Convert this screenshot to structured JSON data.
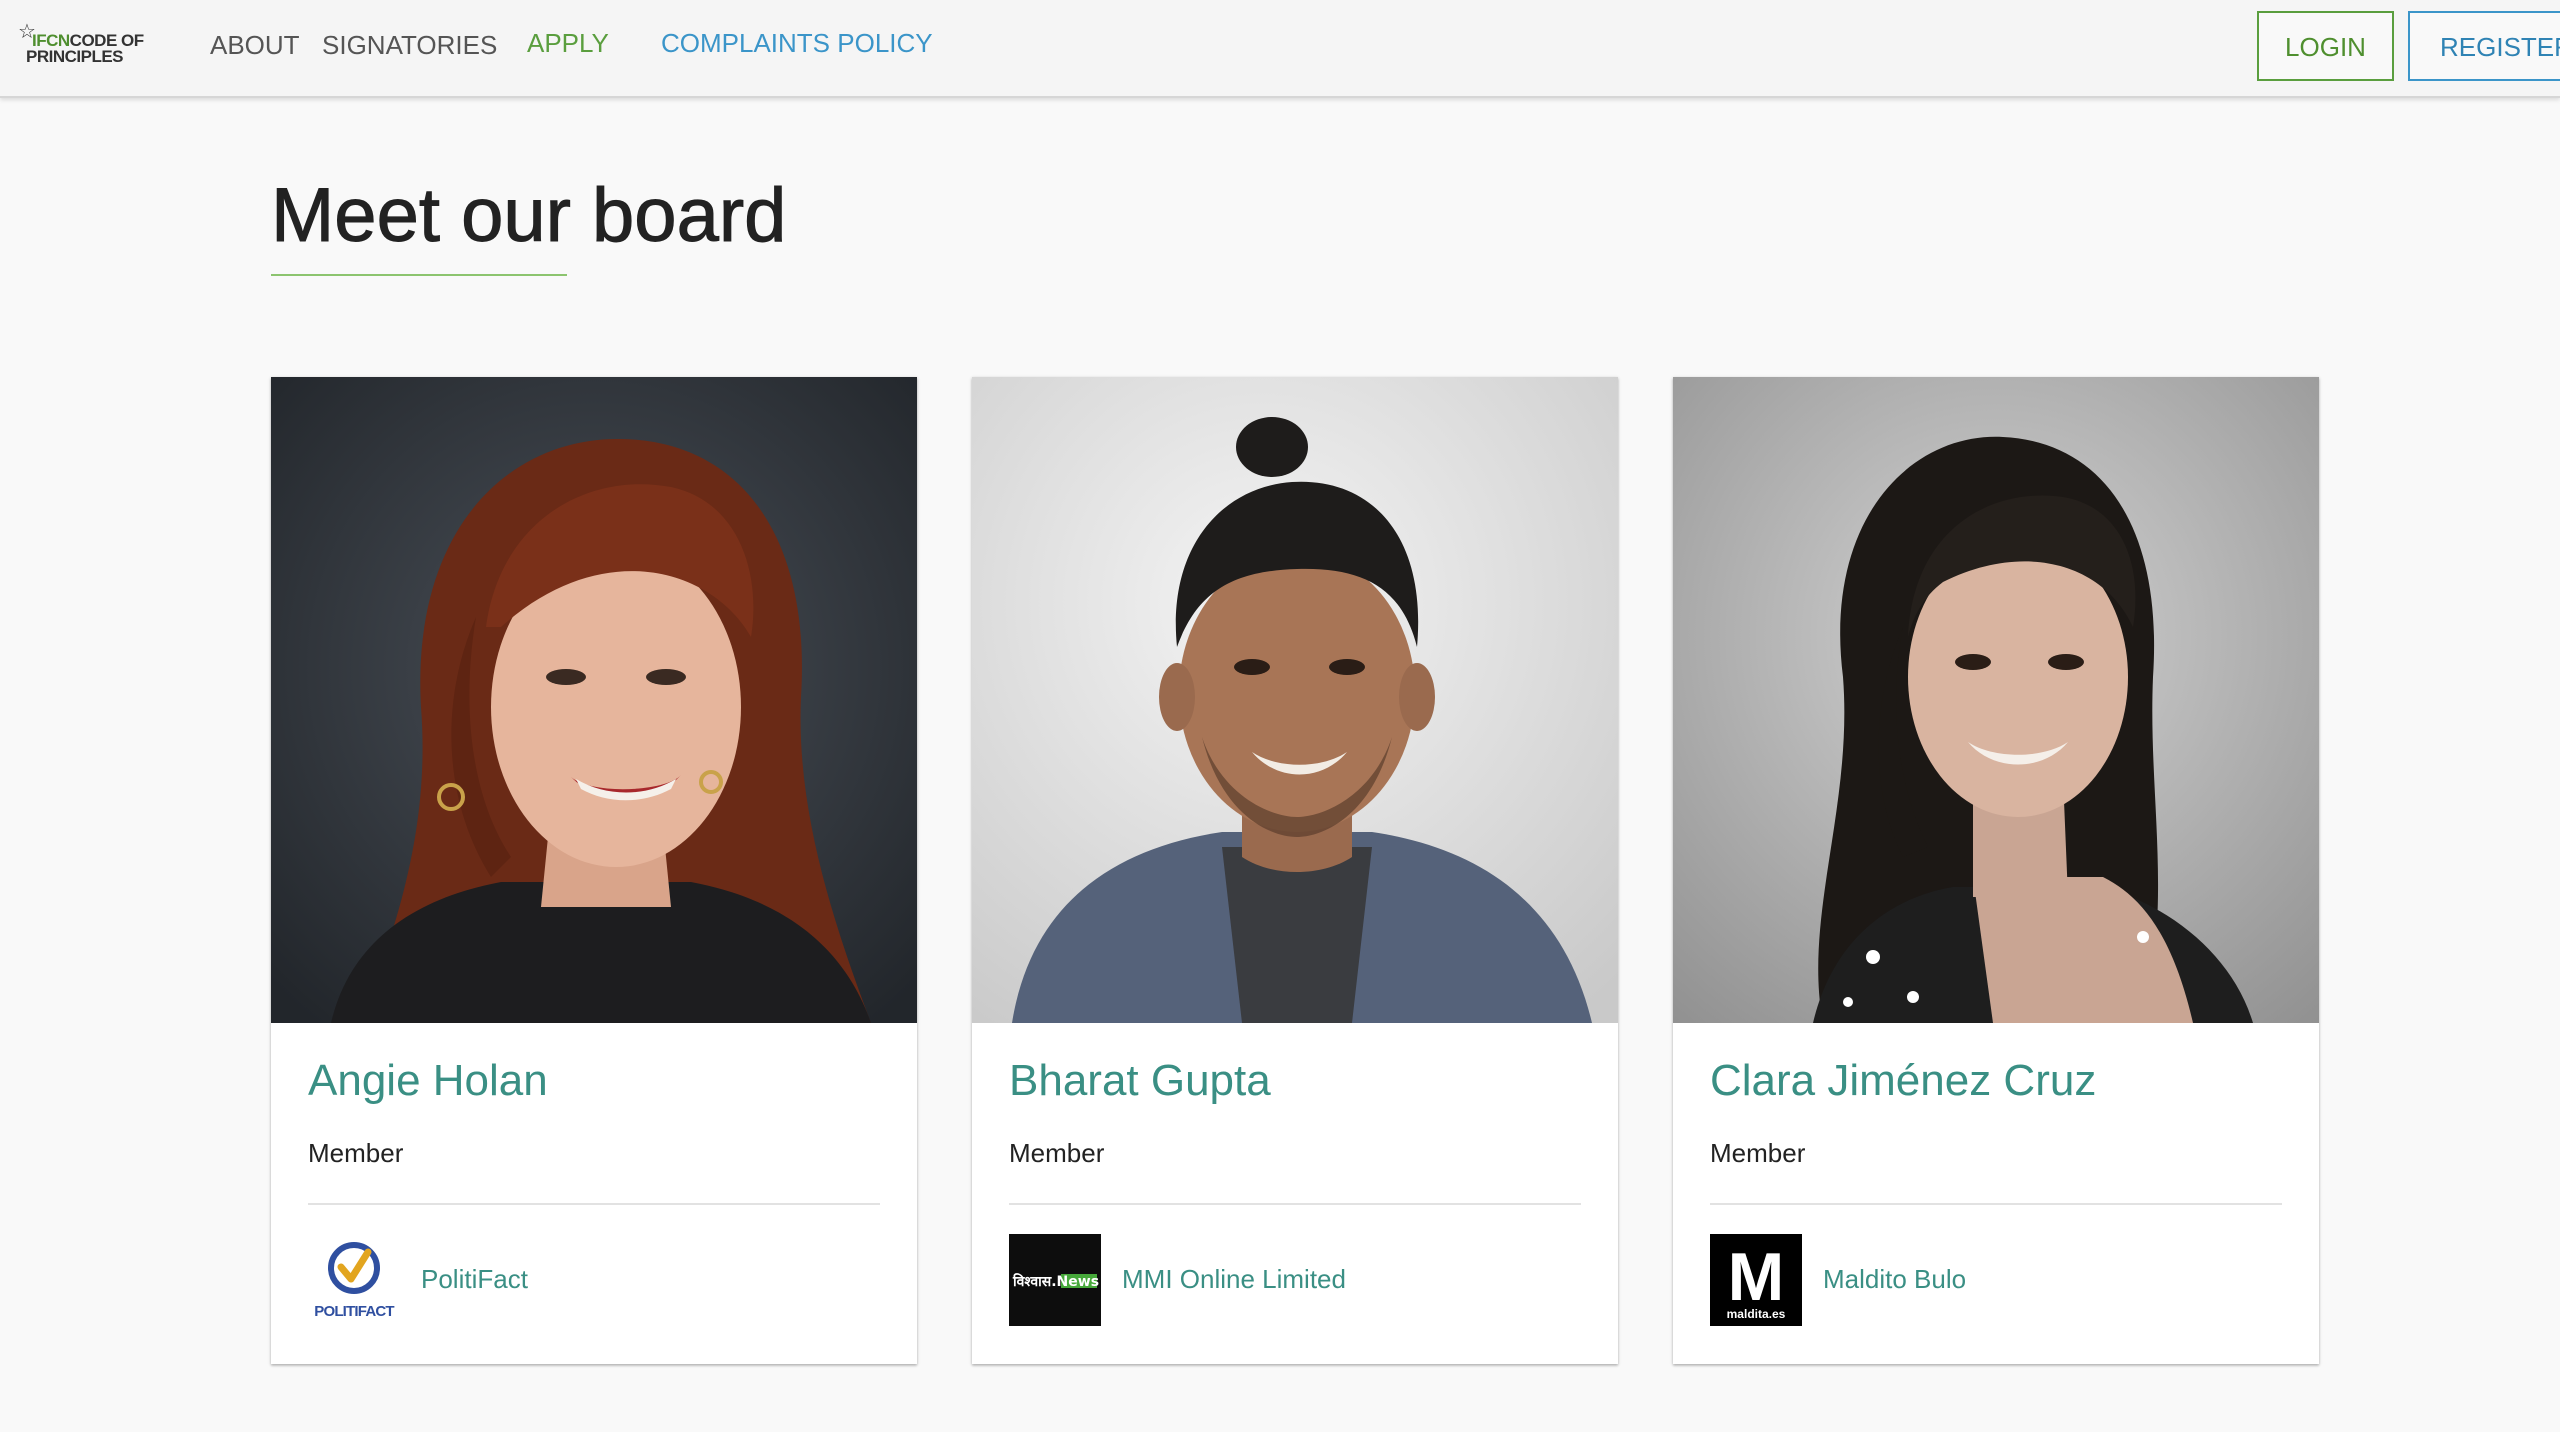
{
  "nav": {
    "logo_line1_prefix": "IFCN",
    "logo_line1_rest": "CODE OF",
    "logo_line2": "PRINCIPLES",
    "about": "ABOUT",
    "signatories": "SIGNATORIES",
    "apply": "APPLY",
    "complaints": "COMPLAINTS POLICY",
    "login": "LOGIN",
    "register": "REGISTER"
  },
  "page": {
    "title": "Meet our board"
  },
  "board": [
    {
      "name": "Angie Holan",
      "role": "Member",
      "org": "PolitiFact",
      "org_logo_text": "POLITIFACT"
    },
    {
      "name": "Bharat Gupta",
      "role": "Member",
      "org": "MMI Online Limited",
      "org_logo_text": "विश्वास.News"
    },
    {
      "name": "Clara Jiménez Cruz",
      "role": "Member",
      "org": "Maldito Bulo",
      "org_logo_text": "maldita.es"
    }
  ],
  "colors": {
    "green_accent": "#5a9e3e",
    "blue_accent": "#3b95c9",
    "teal_link": "#3a8f84"
  }
}
